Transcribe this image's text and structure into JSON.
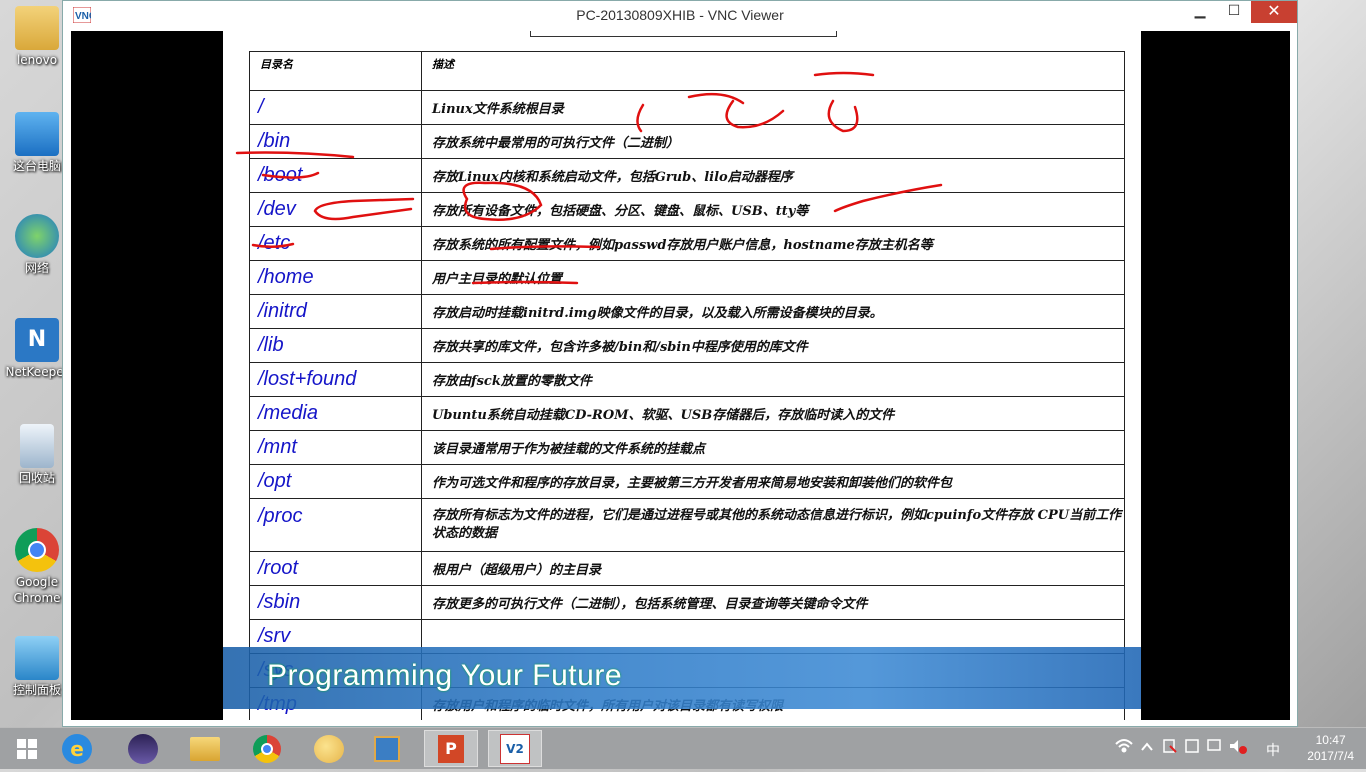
{
  "desktop": {
    "icons": [
      {
        "label": "lenovo"
      },
      {
        "label": "这台电脑"
      },
      {
        "label": "网络"
      },
      {
        "label": "NetKeeper"
      },
      {
        "label": "回收站"
      },
      {
        "label": "Google Chrome"
      },
      {
        "label": "控制面板"
      }
    ]
  },
  "window": {
    "app_icon": "VNC",
    "title": "PC-20130809XHIB - VNC Viewer",
    "minimize": "▁",
    "maximize": "☐",
    "close": "✕"
  },
  "slide": {
    "header": {
      "name": "目录名",
      "desc": "描述"
    },
    "rows": [
      {
        "dir": "/",
        "desc": "Linux文件系统根目录"
      },
      {
        "dir": "/bin",
        "desc": "存放系统中最常用的可执行文件（二进制）"
      },
      {
        "dir": "/boot",
        "desc": "存放Linux内核和系统启动文件，包括Grub、lilo启动器程序"
      },
      {
        "dir": "/dev",
        "desc": "存放所有设备文件，包括硬盘、分区、键盘、鼠标、USB、tty等"
      },
      {
        "dir": "/etc",
        "desc": "存放系统的所有配置文件，例如passwd存放用户账户信息，hostname存放主机名等"
      },
      {
        "dir": "/home",
        "desc": "用户主目录的默认位置"
      },
      {
        "dir": "/initrd",
        "desc": "存放启动时挂载initrd.img映像文件的目录，以及载入所需设备模块的目录。"
      },
      {
        "dir": "/lib",
        "desc": "存放共享的库文件，包含许多被/bin和/sbin中程序使用的库文件"
      },
      {
        "dir": "/lost+found",
        "desc": "存放由fsck放置的零散文件"
      },
      {
        "dir": "/media",
        "desc": "Ubuntu系统自动挂载CD-ROM、软驱、USB存储器后，存放临时读入的文件"
      },
      {
        "dir": "/mnt",
        "desc": "该目录通常用于作为被挂载的文件系统的挂载点"
      },
      {
        "dir": "/opt",
        "desc": "作为可选文件和程序的存放目录，主要被第三方开发者用来简易地安装和卸装他们的软件包"
      },
      {
        "dir": "/proc",
        "desc": "存放所有标志为文件的进程，它们是通过进程号或其他的系统动态信息进行标识，例如cpuinfo文件存放 CPU当前工作状态的数据",
        "tall": true
      },
      {
        "dir": "/root",
        "desc": "根用户（超级用户）的主目录"
      },
      {
        "dir": "/sbin",
        "desc": "存放更多的可执行文件（二进制），包括系统管理、目录查询等关键命令文件"
      },
      {
        "dir": "/srv",
        "desc": ""
      },
      {
        "dir": "/sys",
        "desc": ""
      },
      {
        "dir": "/tmp",
        "desc": "存放用户和程序的临时文件，所有用户对该目录都有读写权限"
      }
    ],
    "banner": "Programming Your Future"
  },
  "colors": {
    "dir_text": "#1515c8",
    "annotation": "#e01010",
    "banner": "#2f7cc8",
    "close_button": "#c84031"
  },
  "taskbar": {
    "items": [
      "start-icon",
      "ie-icon",
      "eclipse-icon",
      "file-explorer-icon",
      "chrome-icon",
      "paint-icon",
      "virtualbox-icon",
      "powerpoint-icon",
      "vnc-icon"
    ],
    "ime": "中",
    "time": "10:47",
    "date": "2017/7/4"
  }
}
